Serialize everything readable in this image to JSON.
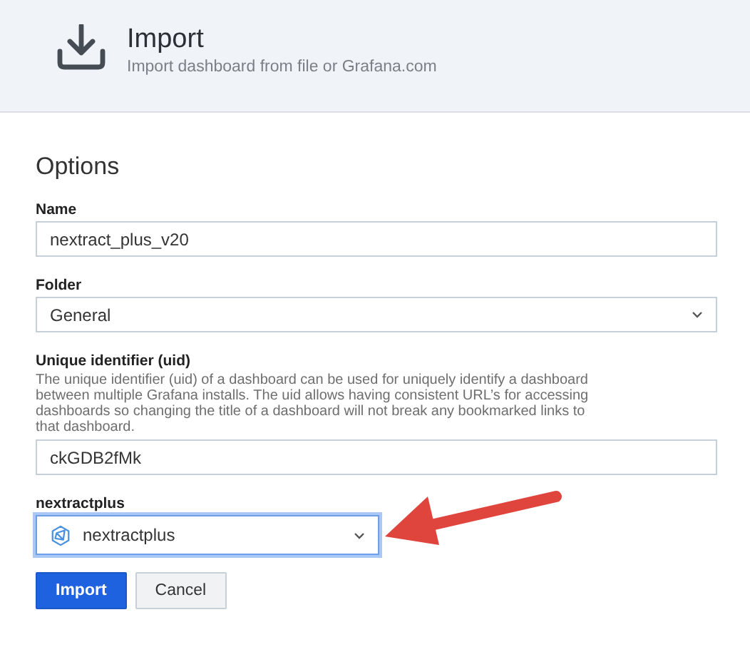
{
  "header": {
    "title": "Import",
    "subtitle": "Import dashboard from file or Grafana.com"
  },
  "options": {
    "heading": "Options",
    "fields": [
      {
        "kind": "text",
        "label": "Name",
        "value": "nextract_plus_v20"
      },
      {
        "kind": "select",
        "label": "Folder",
        "value": "General",
        "focused": false
      },
      {
        "kind": "text",
        "label": "Unique identifier (uid)",
        "description": "The unique identifier (uid) of a dashboard can be used for uniquely identify a dashboard between multiple Grafana installs. The uid allows having consistent URL’s for accessing dashboards so changing the title of a dashboard will not break any bookmarked links to that dashboard.",
        "value": "ckGDB2fMk"
      },
      {
        "kind": "datasource",
        "label": "nextractplus",
        "value": "nextractplus",
        "focused": true
      }
    ]
  },
  "buttons": [
    {
      "label": "Import",
      "kind": "primary"
    },
    {
      "label": "Cancel",
      "kind": "secondary"
    }
  ]
}
